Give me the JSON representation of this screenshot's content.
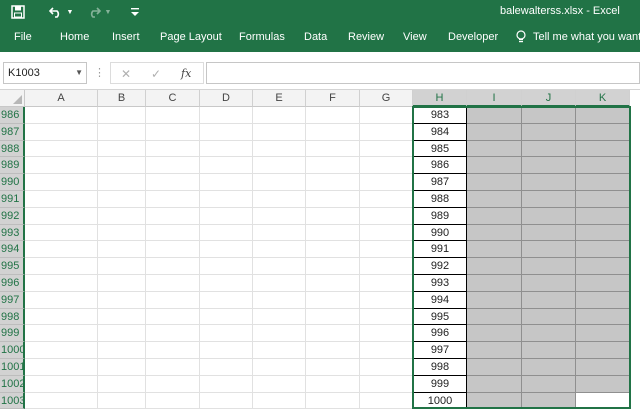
{
  "app": {
    "window_title": "balewalterss.xlsx - Excel"
  },
  "colors": {
    "accent": "#217346",
    "selection_fill": "#c6c6c6",
    "header_fill": "#f3f3f3"
  },
  "quick_access": {
    "icons": [
      "save-icon",
      "undo-icon",
      "redo-icon",
      "customize-qat-icon"
    ]
  },
  "ribbon": {
    "tabs": [
      "File",
      "Home",
      "Insert",
      "Page Layout",
      "Formulas",
      "Data",
      "Review",
      "View",
      "Developer"
    ],
    "tell_me": "Tell me what you want to do"
  },
  "formula_bar": {
    "name_box": "K1003",
    "formula": ""
  },
  "grid": {
    "columns": [
      "A",
      "B",
      "C",
      "D",
      "E",
      "F",
      "G",
      "H",
      "I",
      "J",
      "K"
    ],
    "selected_columns": [
      "H",
      "I",
      "J",
      "K"
    ],
    "rows": [
      "986",
      "987",
      "988",
      "989",
      "990",
      "991",
      "992",
      "993",
      "994",
      "995",
      "996",
      "997",
      "998",
      "999",
      "1000",
      "1001",
      "1002",
      "1003"
    ],
    "column_h_values": [
      "983",
      "984",
      "985",
      "986",
      "987",
      "988",
      "989",
      "990",
      "991",
      "992",
      "993",
      "994",
      "995",
      "996",
      "997",
      "998",
      "999",
      "1000"
    ],
    "active_cell": "K1003"
  }
}
